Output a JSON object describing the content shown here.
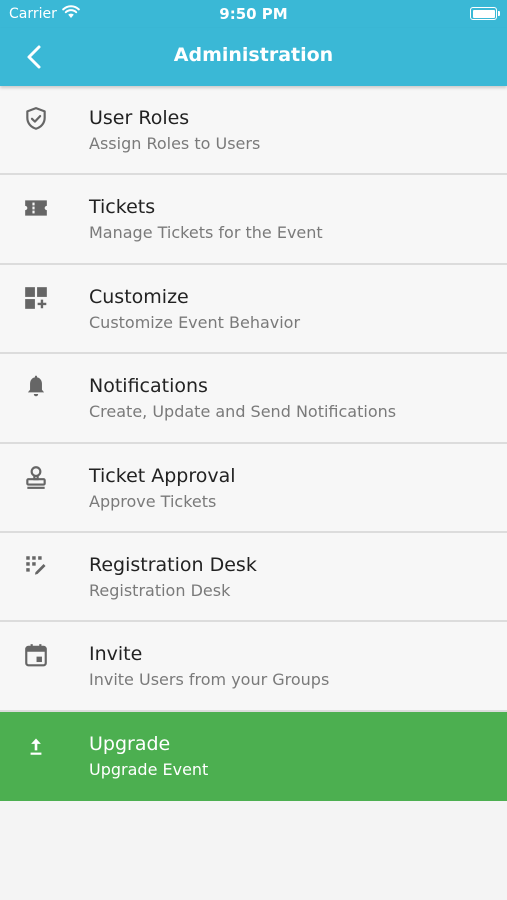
{
  "status_bar": {
    "carrier": "Carrier",
    "time": "9:50 PM"
  },
  "header": {
    "title": "Administration"
  },
  "accent_color": "#3ab8d6",
  "upgrade_color": "#4caf50",
  "items": [
    {
      "label": "User Roles",
      "sub": "Assign Roles to Users",
      "icon": "shield-check-icon"
    },
    {
      "label": "Tickets",
      "sub": "Manage Tickets for the Event",
      "icon": "ticket-icon"
    },
    {
      "label": "Customize",
      "sub": "Customize Event Behavior",
      "icon": "dashboard-add-icon"
    },
    {
      "label": "Notifications",
      "sub": "Create, Update and Send Notifications",
      "icon": "bell-icon"
    },
    {
      "label": "Ticket Approval",
      "sub": "Approve Tickets",
      "icon": "stamp-icon"
    },
    {
      "label": "Registration Desk",
      "sub": "Registration Desk",
      "icon": "keypad-edit-icon"
    },
    {
      "label": "Invite",
      "sub": "Invite Users from your Groups",
      "icon": "calendar-icon"
    },
    {
      "label": "Upgrade",
      "sub": "Upgrade Event",
      "icon": "upload-arrow-icon"
    }
  ]
}
